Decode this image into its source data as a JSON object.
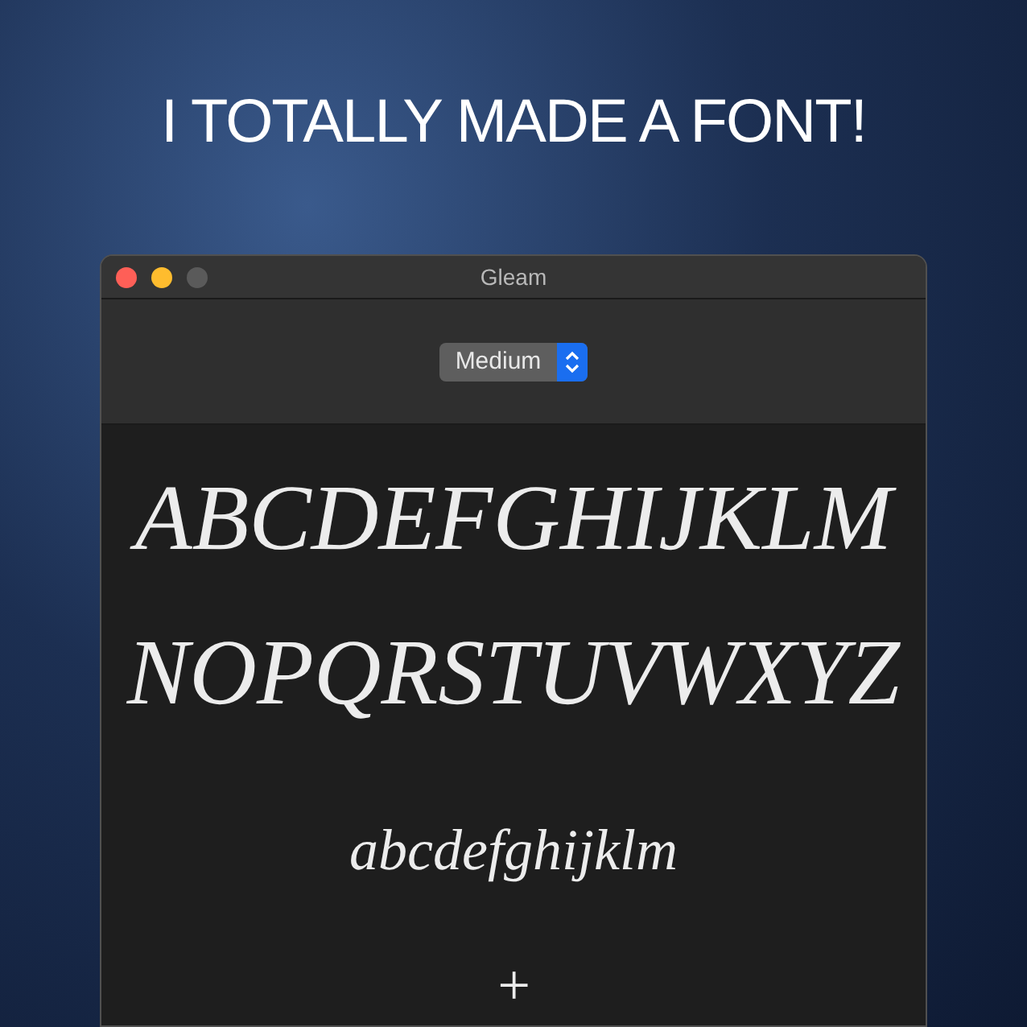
{
  "caption": "I TOTALLY MADE A FONT!",
  "window": {
    "title": "Gleam",
    "controls": [
      {
        "kind": "close",
        "disabled": false
      },
      {
        "kind": "minimize",
        "disabled": false
      },
      {
        "kind": "zoom",
        "disabled": true
      }
    ]
  },
  "style_popup": {
    "value": "Medium"
  },
  "sample_lines": [
    {
      "text": "ABCDEFGHIJKLM",
      "kind": "upper"
    },
    {
      "text": "NOPQRSTUVWXYZ",
      "kind": "upper"
    },
    {
      "text": "abcdefghijklm",
      "kind": "lower"
    },
    {
      "text": "+",
      "kind": "lower"
    }
  ]
}
